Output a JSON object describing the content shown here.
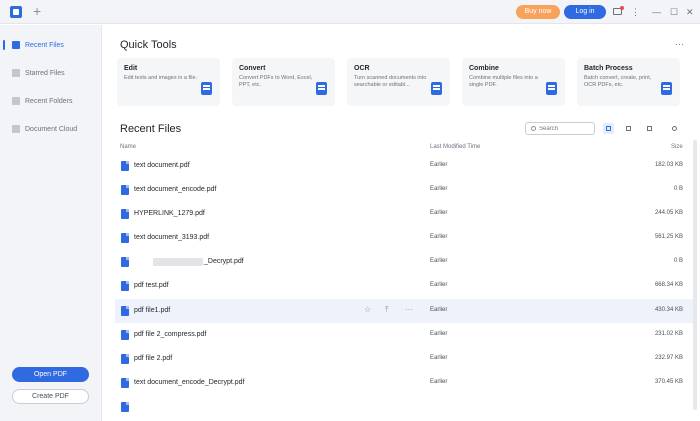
{
  "titlebar": {
    "buy_label": "Buy now",
    "login_label": "Log in",
    "new_tab_label": "+",
    "menu_label": "⋮",
    "minimize_label": "—",
    "maximize_label": "☐",
    "close_label": "✕"
  },
  "sidebar": {
    "items": [
      {
        "label": "Recent Files",
        "icon": "clock-icon",
        "active": true
      },
      {
        "label": "Starred Files",
        "icon": "star-icon",
        "active": false
      },
      {
        "label": "Recent Folders",
        "icon": "folder-icon",
        "active": false
      },
      {
        "label": "Document Cloud",
        "icon": "cloud-icon",
        "active": false
      }
    ],
    "open_label": "Open PDF",
    "create_label": "Create PDF"
  },
  "quick_tools": {
    "title": "Quick Tools",
    "more": "···",
    "tools": [
      {
        "title": "Edit",
        "desc": "Edit texts and images in a file."
      },
      {
        "title": "Convert",
        "desc": "Convert PDFs to Word, Excel, PPT, etc."
      },
      {
        "title": "OCR",
        "desc": "Turn scanned documents into searchable or editabl..."
      },
      {
        "title": "Combine",
        "desc": "Combine multiple files into a single PDF."
      },
      {
        "title": "Batch Process",
        "desc": "Batch convert, create, print, OCR PDFs, etc."
      }
    ]
  },
  "recent": {
    "title": "Recent Files",
    "search_placeholder": "Search",
    "columns": {
      "name": "Name",
      "modified": "Last Modified Time",
      "size": "Size"
    },
    "files": [
      {
        "name": "text document.pdf",
        "modified": "Earlier",
        "size": "182.03 KB"
      },
      {
        "name": "text document_encode.pdf",
        "modified": "Earlier",
        "size": "0 B"
      },
      {
        "name": "HYPERLINK_1279.pdf",
        "modified": "Earlier",
        "size": "244.05 KB"
      },
      {
        "name": "text document_3193.pdf",
        "modified": "Earlier",
        "size": "561.25 KB"
      },
      {
        "name": "_Decrypt.pdf",
        "modified": "Earlier",
        "size": "0 B"
      },
      {
        "name": "pdf test.pdf",
        "modified": "Earlier",
        "size": "668.34 KB"
      },
      {
        "name": "pdf file1.pdf",
        "modified": "Earlier",
        "size": "430.34 KB"
      },
      {
        "name": "pdf file 2_compress.pdf",
        "modified": "Earlier",
        "size": "231.02 KB"
      },
      {
        "name": "pdf file 2.pdf",
        "modified": "Earlier",
        "size": "232.97 KB"
      },
      {
        "name": "text document_encode_Decrypt.pdf",
        "modified": "Earlier",
        "size": "370.45 KB"
      }
    ],
    "row_actions": {
      "star": "☆",
      "upload": "⤒",
      "more": "···"
    }
  },
  "colors": {
    "accent": "#2f6ae1",
    "buy": "#f7a35c",
    "sidebar_bg": "#f3f4f7"
  }
}
